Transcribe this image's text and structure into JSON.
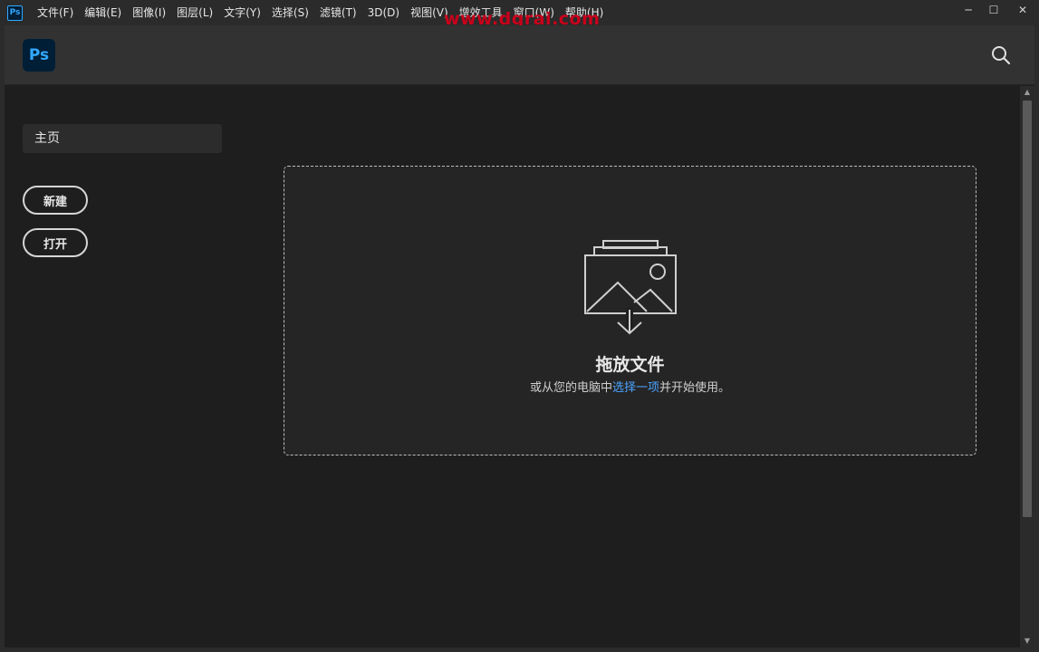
{
  "app": {
    "icon_text": "Ps",
    "logo_text": "Ps",
    "accent": "#31a8ff",
    "logo_bg": "#001e36"
  },
  "menu": [
    {
      "id": "file",
      "label": "文件(F)"
    },
    {
      "id": "edit",
      "label": "编辑(E)"
    },
    {
      "id": "image",
      "label": "图像(I)"
    },
    {
      "id": "layer",
      "label": "图层(L)"
    },
    {
      "id": "type",
      "label": "文字(Y)"
    },
    {
      "id": "select",
      "label": "选择(S)"
    },
    {
      "id": "filter",
      "label": "滤镜(T)"
    },
    {
      "id": "3d",
      "label": "3D(D)"
    },
    {
      "id": "view",
      "label": "视图(V)"
    },
    {
      "id": "plugins",
      "label": "增效工具"
    },
    {
      "id": "window",
      "label": "窗口(W)"
    },
    {
      "id": "help",
      "label": "帮助(H)"
    }
  ],
  "watermark": "www.dgrai.com",
  "window_controls": {
    "minimize": "─",
    "maximize": "☐",
    "close": "✕"
  },
  "header": {
    "search_icon": "search-icon"
  },
  "sidebar": {
    "home_label": "主页",
    "new_button": "新建",
    "open_button": "打开"
  },
  "dropzone": {
    "title": "拖放文件",
    "subtitle_prefix": "或从您的电脑中",
    "subtitle_link": "选择一项",
    "subtitle_suffix": "并开始使用。",
    "link_color": "#4ba4ff"
  }
}
